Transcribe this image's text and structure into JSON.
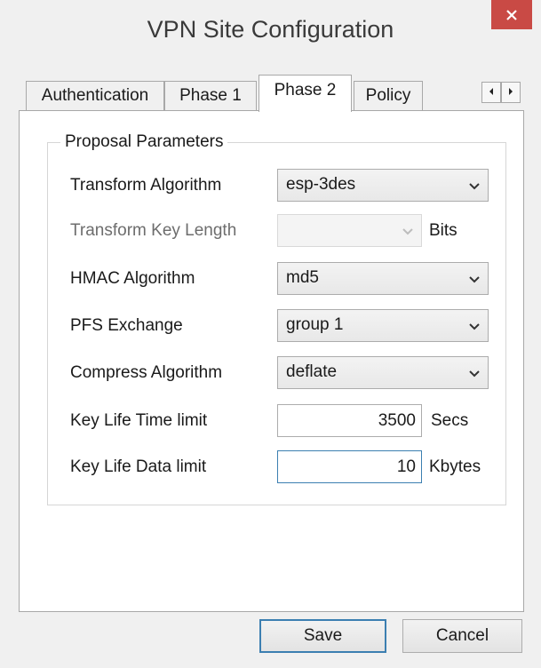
{
  "window": {
    "title": "VPN Site Configuration"
  },
  "tabs": [
    {
      "label": "Authentication",
      "active": false
    },
    {
      "label": "Phase 1",
      "active": false
    },
    {
      "label": "Phase 2",
      "active": true
    },
    {
      "label": "Policy",
      "active": false
    }
  ],
  "group": {
    "legend": "Proposal Parameters"
  },
  "fields": {
    "transform_algorithm": {
      "label": "Transform Algorithm",
      "value": "esp-3des"
    },
    "transform_key_length": {
      "label": "Transform Key Length",
      "value": "",
      "unit": "Bits",
      "disabled": true
    },
    "hmac_algorithm": {
      "label": "HMAC Algorithm",
      "value": "md5"
    },
    "pfs_exchange": {
      "label": "PFS Exchange",
      "value": "group 1"
    },
    "compress_algorithm": {
      "label": "Compress Algorithm",
      "value": "deflate"
    },
    "key_life_time": {
      "label": "Key Life Time limit",
      "value": "3500",
      "unit": "Secs"
    },
    "key_life_data": {
      "label": "Key Life Data limit",
      "value": "10",
      "unit": "Kbytes"
    }
  },
  "buttons": {
    "save": "Save",
    "cancel": "Cancel"
  },
  "icons": {
    "close": "close-icon",
    "scroll_left": "arrow-left-icon",
    "scroll_right": "arrow-right-icon",
    "dropdown": "chevron-down-icon"
  },
  "colors": {
    "close_button": "#c94a45",
    "focus_border": "#3c7fb1",
    "dialog_background": "#f0f0f0"
  }
}
